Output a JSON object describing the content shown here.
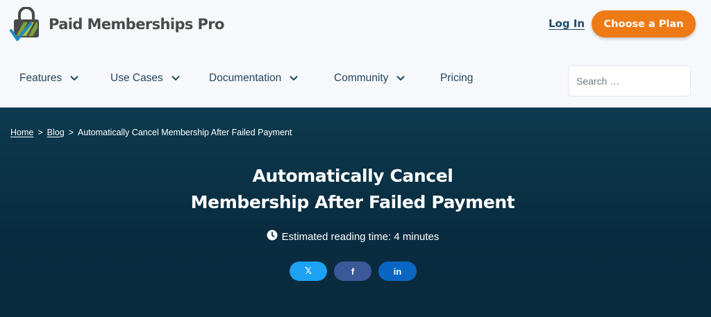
{
  "brand": {
    "name": "Paid Memberships Pro",
    "logo_icon": "lock-check-logo-icon"
  },
  "header": {
    "login_label": "Log In",
    "cta_label": "Choose a Plan"
  },
  "nav": {
    "items": [
      {
        "label": "Features",
        "has_dropdown": true
      },
      {
        "label": "Use Cases",
        "has_dropdown": true
      },
      {
        "label": "Documentation",
        "has_dropdown": true
      },
      {
        "label": "Community",
        "has_dropdown": true
      },
      {
        "label": "Pricing",
        "has_dropdown": false
      }
    ]
  },
  "search": {
    "placeholder": "Search …"
  },
  "breadcrumb": {
    "home": "Home",
    "sep": ">",
    "blog": "Blog",
    "current": "Automatically Cancel Membership After Failed Payment"
  },
  "article": {
    "title_line1": "Automatically Cancel",
    "title_line2": "Membership After Failed Payment",
    "reading_time": "Estimated reading time: 4 minutes"
  },
  "share": {
    "x_icon": "𝕏",
    "facebook_icon": "f",
    "linkedin_icon": "in"
  },
  "colors": {
    "accent": "#ed7a14",
    "hero_bg": "#0c3a4e",
    "nav_text": "#24455f",
    "x_blue": "#1da1f2",
    "facebook_blue": "#3b5998",
    "linkedin_blue": "#0a66c2"
  }
}
